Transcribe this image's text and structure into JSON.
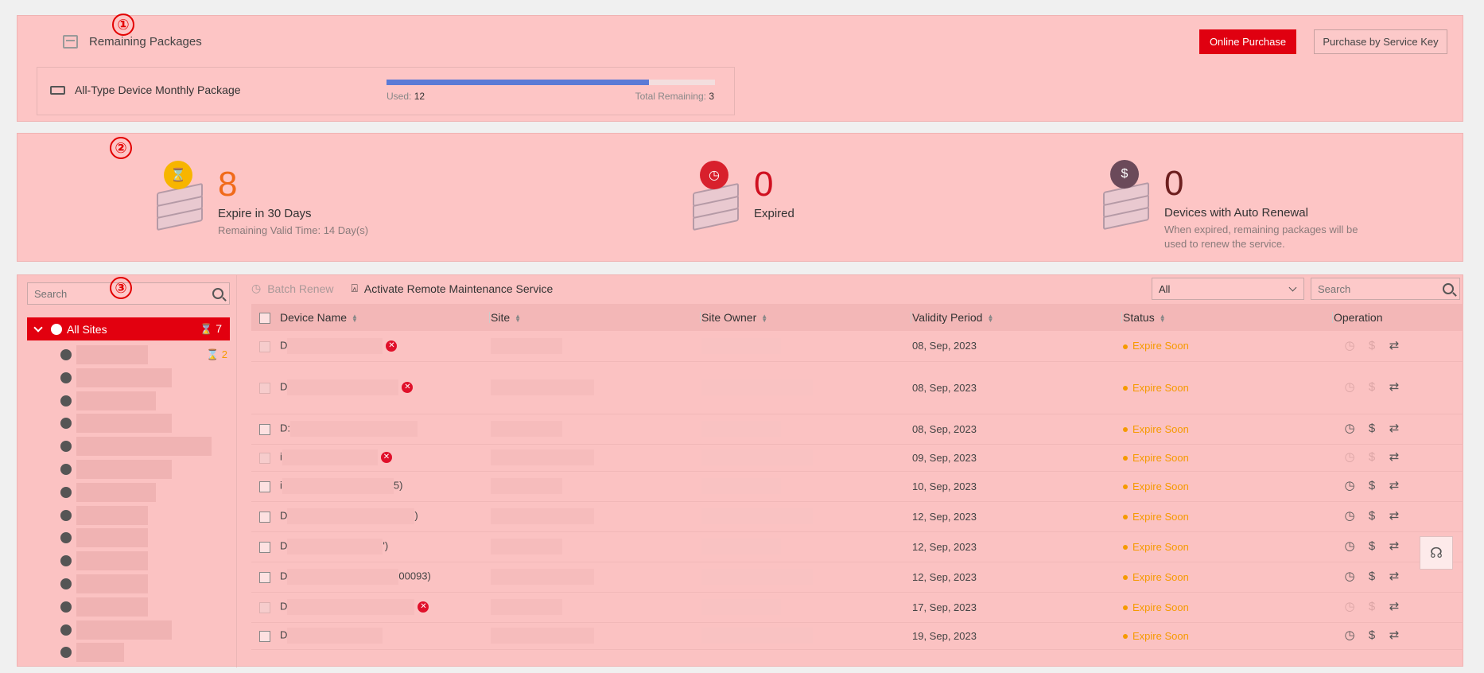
{
  "callouts": {
    "one": "①",
    "two": "②",
    "three": "③"
  },
  "remaining_packages": {
    "title": "Remaining Packages",
    "online_purchase": "Online Purchase",
    "purchase_by_key": "Purchase by Service Key",
    "package_name": "All-Type Device Monthly Package",
    "used_label": "Used:",
    "used_value": "12",
    "total_label": "Total Remaining:",
    "total_value": "3",
    "used_fraction": 0.8
  },
  "stats": {
    "expire": {
      "number": "8",
      "label": "Expire in 30 Days",
      "sub": "Remaining Valid Time: 14 Day(s)",
      "color": "#f06a1a"
    },
    "expired": {
      "number": "0",
      "label": "Expired",
      "color": "#d01020"
    },
    "auto": {
      "number": "0",
      "label": "Devices with Auto Renewal",
      "sub": "When expired, remaining packages will be used to renew the service.",
      "color": "#6d1f1f"
    }
  },
  "tree": {
    "search_placeholder": "Search",
    "all_sites_label": "All Sites",
    "all_sites_count": "7",
    "first_child_count": "2"
  },
  "toolbar": {
    "batch_renew": "Batch Renew",
    "activate_remote": "Activate Remote Maintenance Service",
    "filter_value": "All",
    "search_placeholder": "Search"
  },
  "table": {
    "headers": {
      "device_name": "Device Name",
      "site": "Site",
      "site_owner": "Site Owner",
      "validity": "Validity Period",
      "status": "Status",
      "operation": "Operation"
    },
    "rows": [
      {
        "prefix": "D",
        "suffix": "",
        "date": "08, Sep, 2023",
        "status": "Expire Soon",
        "err": true
      },
      {
        "prefix": "D",
        "suffix": "",
        "date": "08, Sep, 2023",
        "status": "Expire Soon",
        "err": true
      },
      {
        "prefix": "D:",
        "suffix": "",
        "date": "08, Sep, 2023",
        "status": "Expire Soon",
        "err": false
      },
      {
        "prefix": "i",
        "suffix": "",
        "date": "09, Sep, 2023",
        "status": "Expire Soon",
        "err": true
      },
      {
        "prefix": "i",
        "suffix": "5)",
        "date": "10, Sep, 2023",
        "status": "Expire Soon",
        "err": false
      },
      {
        "prefix": "D",
        "suffix": ")",
        "date": "12, Sep, 2023",
        "status": "Expire Soon",
        "err": false
      },
      {
        "prefix": "D",
        "suffix": "')",
        "date": "12, Sep, 2023",
        "status": "Expire Soon",
        "err": false
      },
      {
        "prefix": "D",
        "suffix": "00093)",
        "date": "12, Sep, 2023",
        "status": "Expire Soon",
        "err": false
      },
      {
        "prefix": "D",
        "suffix": "",
        "date": "17, Sep, 2023",
        "status": "Expire Soon",
        "err": true
      },
      {
        "prefix": "D",
        "suffix": "",
        "date": "19, Sep, 2023",
        "status": "Expire Soon",
        "err": false
      }
    ]
  },
  "icons": {
    "box": "box-icon",
    "device": "device-icon",
    "hourglass": "hourglass-icon",
    "clock": "clock-icon",
    "renew": "renew-icon",
    "transfer": "transfer-icon",
    "support": "support-icon",
    "globe": "globe-icon"
  }
}
